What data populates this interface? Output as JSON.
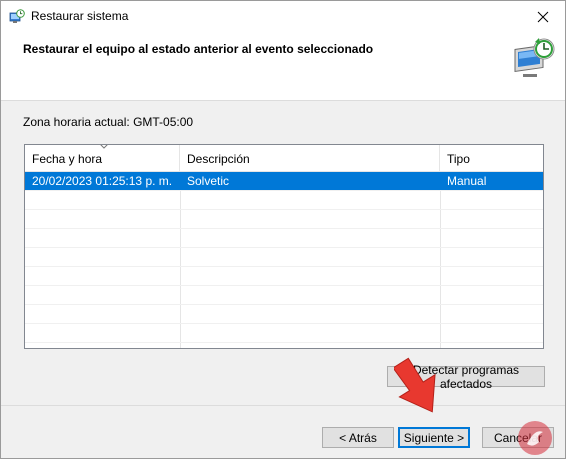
{
  "window": {
    "title": "Restaurar sistema",
    "close_glyph": "✕"
  },
  "header": {
    "title": "Restaurar el equipo al estado anterior al evento seleccionado",
    "icon": "system-restore-icon"
  },
  "timezone_label": "Zona horaria actual: GMT-05:00",
  "list": {
    "columns": [
      "Fecha y hora",
      "Descripción",
      "Tipo"
    ],
    "rows": [
      {
        "date": "20/02/2023 01:25:13 p. m.",
        "description": "Solvetic",
        "type": "Manual",
        "selected": true
      }
    ]
  },
  "buttons": {
    "detect": "Detectar programas afectados",
    "back": "< Atrás",
    "next": "Siguiente >",
    "cancel": "Cancelar"
  },
  "colors": {
    "selection": "#0078d7",
    "annotation_arrow": "#e8382f"
  }
}
